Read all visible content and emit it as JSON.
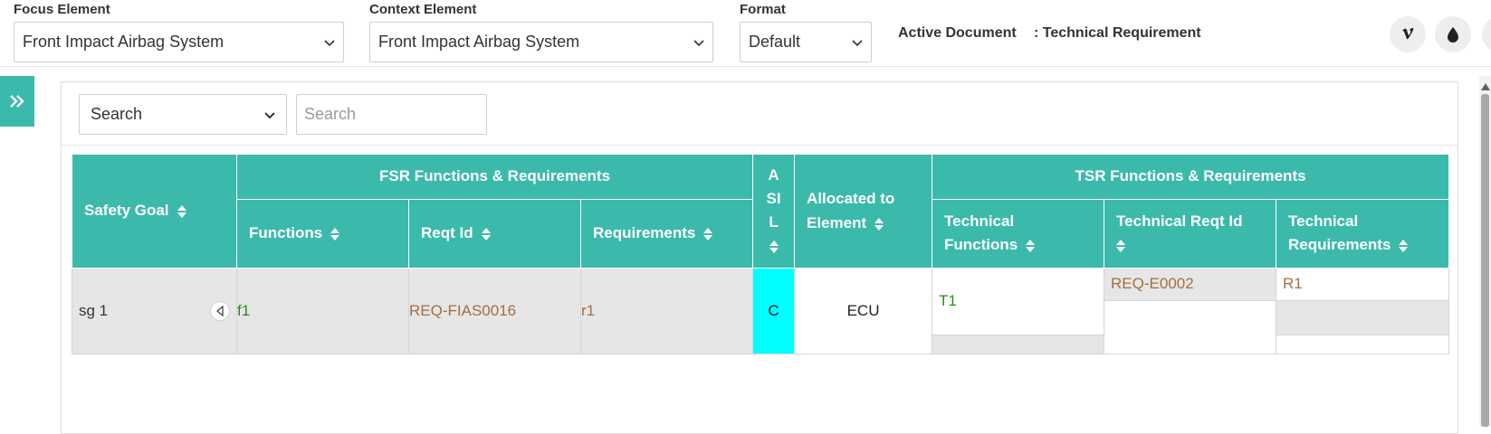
{
  "filters": {
    "focus_label": "Focus Element",
    "focus_value": "Front Impact Airbag System",
    "context_label": "Context Element",
    "context_value": "Front Impact Airbag System",
    "format_label": "Format",
    "format_value": "Default",
    "active_doc_label": "Active Document",
    "active_doc_value": ": Technical Requirement"
  },
  "toolbar": {
    "icons": [
      "vimeo-icon",
      "water-drop-icon",
      "partial-round-button"
    ]
  },
  "search": {
    "field_select": "Search",
    "placeholder": "Search"
  },
  "table": {
    "header": {
      "safety_goal": "Safety Goal",
      "fsr_group": "FSR Functions & Requirements",
      "functions": "Functions",
      "reqt_id": "Reqt Id",
      "requirements": "Requirements",
      "asil_a": "A",
      "asil_si": "SI",
      "asil_l": "L",
      "allocated": "Allocated to Element",
      "tsr_group": "TSR Functions & Requirements",
      "tech_functions": "Technical Functions",
      "tech_reqt_id": "Technical Reqt Id",
      "tech_requirements": "Technical Requirements"
    },
    "row": {
      "safety_goal": "sg 1",
      "function": "f1",
      "reqt_id": "REQ-FIAS0016",
      "requirement": "r1",
      "asil": "C",
      "allocated": "ECU",
      "tech_function": "T1",
      "tech_reqt_id": "REQ-E0002",
      "tech_requirement": "R1"
    }
  },
  "colors": {
    "accent": "#3bbaab",
    "asil_c": "#00ffff",
    "link_green": "#2b8a1e",
    "link_brown": "#a07040"
  }
}
